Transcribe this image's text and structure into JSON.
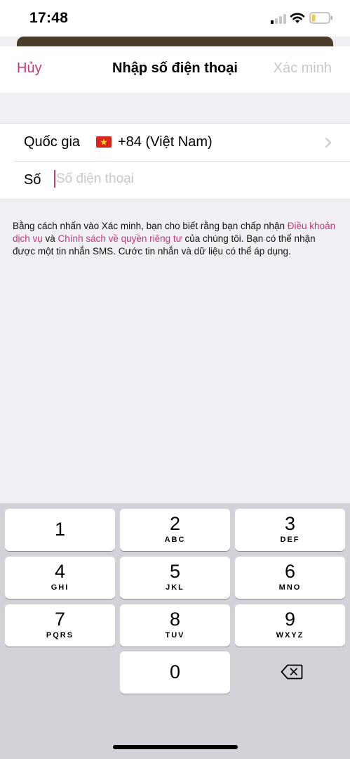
{
  "status_bar": {
    "time": "17:48",
    "icons": [
      "cellular-signal-icon",
      "wifi-icon",
      "battery-icon"
    ]
  },
  "nav": {
    "cancel_label": "Hủy",
    "title": "Nhập số điện thoại",
    "verify_label": "Xác minh"
  },
  "form": {
    "country_label": "Quốc gia",
    "country_flag": "vietnam-flag-icon",
    "country_value": "+84 (Việt Nam)",
    "number_label": "Số",
    "number_placeholder": "Số điện thoại",
    "number_value": ""
  },
  "consent": {
    "part1": "Bằng cách nhấn vào Xác minh, bạn cho biết rằng bạn chấp nhận ",
    "terms_link": "Điều khoản dịch vụ",
    "part2": " và ",
    "privacy_link": "Chính sách về quyền riêng tư",
    "part3": " của chúng tôi. Bạn có thể nhận được một tin nhắn SMS. Cước tin nhắn và dữ liệu có thể áp dụng."
  },
  "keypad": {
    "keys": [
      {
        "digit": "1",
        "letters": ""
      },
      {
        "digit": "2",
        "letters": "ABC"
      },
      {
        "digit": "3",
        "letters": "DEF"
      },
      {
        "digit": "4",
        "letters": "GHI"
      },
      {
        "digit": "5",
        "letters": "JKL"
      },
      {
        "digit": "6",
        "letters": "MNO"
      },
      {
        "digit": "7",
        "letters": "PQRS"
      },
      {
        "digit": "8",
        "letters": "TUV"
      },
      {
        "digit": "9",
        "letters": "WXYZ"
      },
      {
        "digit": "0",
        "letters": ""
      }
    ],
    "delete_icon": "backspace-icon"
  },
  "colors": {
    "accent": "#c2387a",
    "disabled": "#c8c8cc",
    "background": "#efeff4",
    "keyboard_bg": "#d1d3d9"
  }
}
